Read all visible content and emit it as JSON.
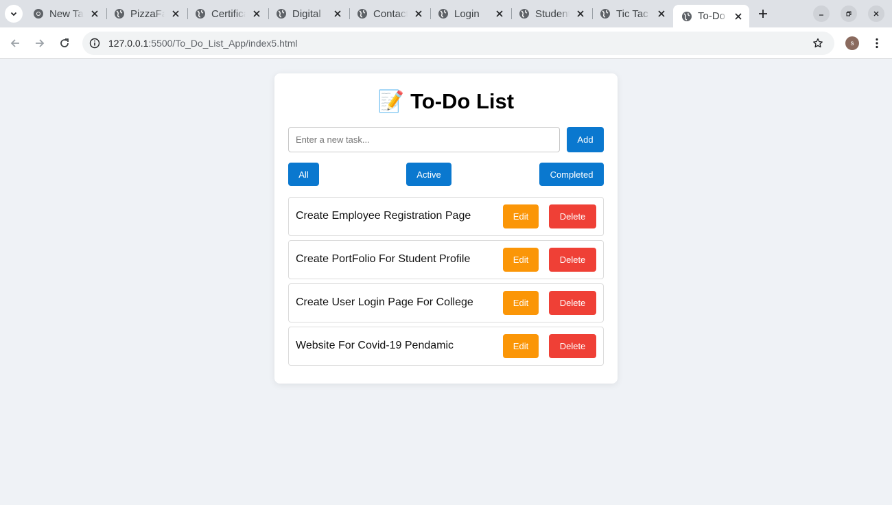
{
  "browser": {
    "tabs": [
      {
        "title": "New Tab",
        "active": false,
        "icon": "chrome-icon"
      },
      {
        "title": "PizzaFactory",
        "active": false,
        "icon": "globe-icon"
      },
      {
        "title": "Certificate",
        "active": false,
        "icon": "globe-icon"
      },
      {
        "title": "Digital",
        "active": false,
        "icon": "globe-icon"
      },
      {
        "title": "Contact",
        "active": false,
        "icon": "globe-icon"
      },
      {
        "title": "Login",
        "active": false,
        "icon": "globe-icon"
      },
      {
        "title": "Student",
        "active": false,
        "icon": "globe-icon"
      },
      {
        "title": "Tic Tac",
        "active": false,
        "icon": "globe-icon"
      },
      {
        "title": "To-Do List",
        "active": true,
        "icon": "globe-icon"
      }
    ],
    "url_host": "127.0.0.1",
    "url_path": ":5500/To_Do_List_App/index5.html",
    "profile_initial": "s"
  },
  "app": {
    "title_emoji": "📝",
    "title": "To-Do List",
    "input_placeholder": "Enter a new task...",
    "input_value": "",
    "add_label": "Add",
    "filters": {
      "all": "All",
      "active": "Active",
      "completed": "Completed"
    },
    "tasks": [
      {
        "text": "Create Employee Registration Page",
        "edit_label": "Edit",
        "delete_label": "Delete"
      },
      {
        "text": "Create PortFolio For Student Profile",
        "edit_label": "Edit",
        "delete_label": "Delete"
      },
      {
        "text": "Create User Login Page For College",
        "edit_label": "Edit",
        "delete_label": "Delete"
      },
      {
        "text": "Website For Covid-19 Pendamic",
        "edit_label": "Edit",
        "delete_label": "Delete"
      }
    ]
  },
  "colors": {
    "primary": "#0a78cf",
    "edit": "#fb9607",
    "delete": "#ef4036",
    "page_bg": "#eff2f6"
  }
}
